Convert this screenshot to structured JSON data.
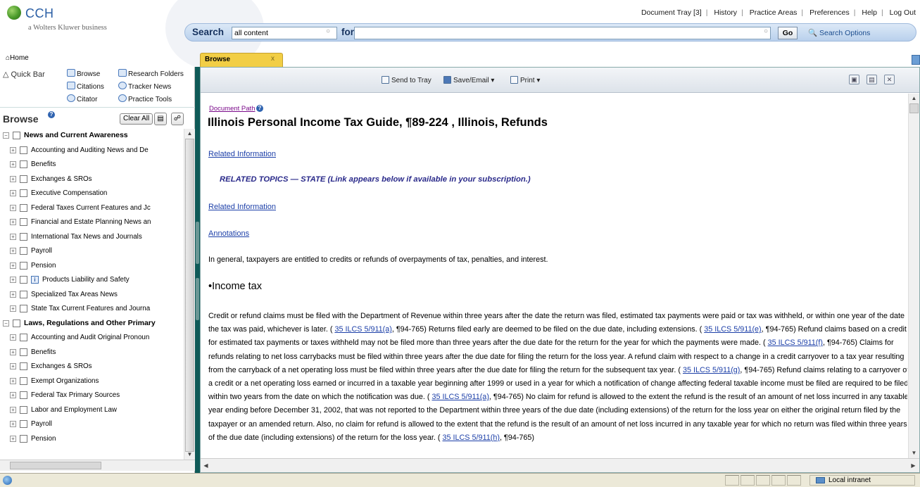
{
  "brand": {
    "name": "CCH",
    "tagline": "a Wolters Kluwer business"
  },
  "top_links": [
    "Document Tray [3]",
    "History",
    "Practice Areas",
    "Preferences",
    "Help",
    "Log Out"
  ],
  "search": {
    "label": "Search",
    "scope_value": "all content",
    "for_label": "for",
    "query_value": "",
    "go_label": "Go",
    "options_label": "Search Options"
  },
  "home_label": "Home",
  "tab": {
    "label": "Browse",
    "close": "x"
  },
  "quickbar": {
    "label": "Quick Bar",
    "items": {
      "browse": "Browse",
      "research_folders": "Research Folders",
      "citations": "Citations",
      "tracker_news": "Tracker News",
      "citator": "Citator",
      "practice_tools": "Practice Tools"
    }
  },
  "browse_panel": {
    "title": "Browse",
    "clear_all": "Clear All",
    "tree": [
      {
        "label": "News and Current Awareness",
        "level": 0
      },
      {
        "label": "Accounting and Auditing News and De",
        "level": 1
      },
      {
        "label": "Benefits",
        "level": 1
      },
      {
        "label": "Exchanges & SROs",
        "level": 1
      },
      {
        "label": "Executive Compensation",
        "level": 1
      },
      {
        "label": "Federal Taxes Current Features and Jc",
        "level": 1
      },
      {
        "label": "Financial and Estate Planning News an",
        "level": 1
      },
      {
        "label": "International Tax News and Journals",
        "level": 1
      },
      {
        "label": "Payroll",
        "level": 1
      },
      {
        "label": "Pension",
        "level": 1
      },
      {
        "label": "Products Liability and Safety",
        "level": 1,
        "info": true
      },
      {
        "label": "Specialized Tax Areas News",
        "level": 1
      },
      {
        "label": "State Tax Current Features and Journa",
        "level": 1
      },
      {
        "label": "Laws, Regulations and Other Primary",
        "level": 0
      },
      {
        "label": "Accounting and Audit Original Pronoun",
        "level": 1
      },
      {
        "label": "Benefits",
        "level": 1
      },
      {
        "label": "Exchanges & SROs",
        "level": 1
      },
      {
        "label": "Exempt Organizations",
        "level": 1
      },
      {
        "label": "Federal Tax Primary Sources",
        "level": 1
      },
      {
        "label": "Labor and Employment Law",
        "level": 1
      },
      {
        "label": "Payroll",
        "level": 1
      },
      {
        "label": "Pension",
        "level": 1
      }
    ]
  },
  "doc_toolbar": {
    "send_to_tray": "Send to Tray",
    "save_email": "Save/Email ▾",
    "print": "Print ▾"
  },
  "document": {
    "path_label": "Document Path",
    "title": "Illinois Personal Income Tax Guide, ¶89-224 , Illinois, Refunds",
    "related_info_1": "Related Information",
    "related_topics": "RELATED TOPICS — STATE (Link appears below if available in your subscription.)",
    "related_info_2": "Related Information",
    "annotations": "Annotations",
    "intro": "In general, taxpayers are entitled to credits or refunds of overpayments of tax, penalties, and interest.",
    "income_heading": "•Income tax",
    "p1": "Credit or refund claims must be filed with the Department of Revenue within three years after the date the return was filed, estimated tax payments were paid or tax was withheld, or within one year of the date the tax was paid, whichever is later. ( ",
    "c1": "35 ILCS 5/911(a)",
    "p2": ", ¶94-765) Returns filed early are deemed to be filed on the due date, including extensions. ( ",
    "c2": "35 ILCS 5/911(e)",
    "p3": ", ¶94-765) Refund claims based on a credit for estimated tax payments or taxes withheld may not be filed more than three years after the due date for the return for the year for which the payments were made. ( ",
    "c3": "35 ILCS 5/911(f)",
    "p4": ", ¶94-765) Claims for refunds relating to net loss carrybacks must be filed within three years after the due date for filing the return for the loss year. A refund claim with respect to a change in a credit carryover to a tax year resulting from the carryback of a net operating loss must be filed within three years after the due date for filing the return for the subsequent tax year. ( ",
    "c4": "35 ILCS 5/911(g)",
    "p5": ", ¶94-765) Refund claims relating to a carryover of a credit or a net operating loss earned or incurred in a taxable year beginning after 1999 or used in a year for which a notification of change affecting federal taxable income must be filed are required to be filed within two years from the date on which the notification was due. ( ",
    "c5": "35 ILCS 5/911(a)",
    "p6": ", ¶94-765) No claim for refund is allowed to the extent the refund is the result of an amount of net loss incurred in any taxable year ending before December 31, 2002, that was not reported to the Department within three years of the due date (including extensions) of the return for the loss year on either the original return filed by the taxpayer or an amended return. Also, no claim for refund is allowed to the extent that the refund is the result of an amount of net loss incurred in any taxable year for which no return was filed within three years of the due date (including extensions) of the return for the loss year. ( ",
    "c6": "35 ILCS 5/911(h)",
    "p7": ", ¶94-765)"
  },
  "status": {
    "zone": "Local intranet"
  }
}
